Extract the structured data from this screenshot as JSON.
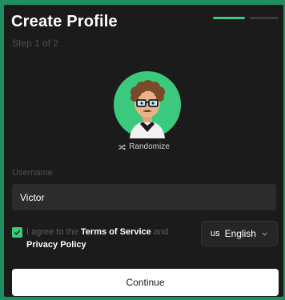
{
  "colors": {
    "accent": "#3ac97d",
    "background": "#1b1b1b",
    "frame": "#1f8f62"
  },
  "header": {
    "title": "Create Profile",
    "step": "Step 1 of 2",
    "progress": {
      "current": 1,
      "total": 2
    }
  },
  "avatar": {
    "icon": "avatar-icon",
    "randomize_label": "Randomize",
    "randomize_icon": "shuffle-icon"
  },
  "username": {
    "label": "Username",
    "value": "Victor"
  },
  "agreement": {
    "checked": true,
    "prefix": "I agree to the ",
    "terms_link": "Terms of Service",
    "middle": " and ",
    "privacy_link": "Privacy Policy"
  },
  "language": {
    "flag": "us",
    "selected": "English",
    "icon": "chevron-down-icon"
  },
  "actions": {
    "continue_label": "Continue"
  }
}
